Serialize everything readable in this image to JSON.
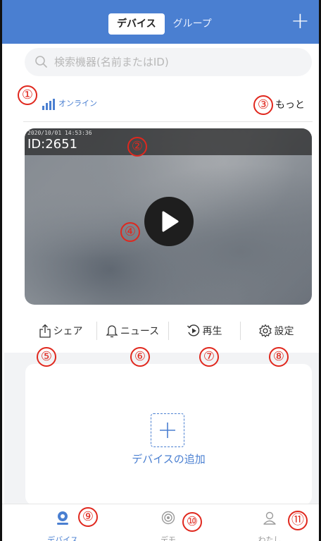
{
  "header": {
    "tabs": [
      {
        "label": "デバイス",
        "active": true
      },
      {
        "label": "グループ",
        "active": false
      }
    ],
    "add_label": "+",
    "accent_color": "#4a7fd1"
  },
  "search": {
    "placeholder": "検索機器(名前またはID)"
  },
  "device": {
    "status": "オンライン",
    "more_label": "もっと",
    "video_timestamp": "2020/10/01 14:53:36",
    "device_id": "ID:2651",
    "actions": [
      {
        "label": "シェア",
        "icon": "share-icon"
      },
      {
        "label": "ニュース",
        "icon": "bell-icon"
      },
      {
        "label": "再生",
        "icon": "playback-icon"
      },
      {
        "label": "設定",
        "icon": "gear-icon"
      }
    ]
  },
  "add_device": {
    "label": "デバイスの追加",
    "icon": "plus-icon"
  },
  "tabbar": {
    "items": [
      {
        "label": "デバイス",
        "icon": "camera-pin-icon",
        "active": true
      },
      {
        "label": "デモ",
        "icon": "demo-icon",
        "active": false
      },
      {
        "label": "わたし",
        "icon": "user-icon",
        "active": false
      }
    ]
  },
  "annotations": [
    "①",
    "②",
    "③",
    "④",
    "⑤",
    "⑥",
    "⑦",
    "⑧",
    "⑨",
    "⑩",
    "⑪"
  ]
}
